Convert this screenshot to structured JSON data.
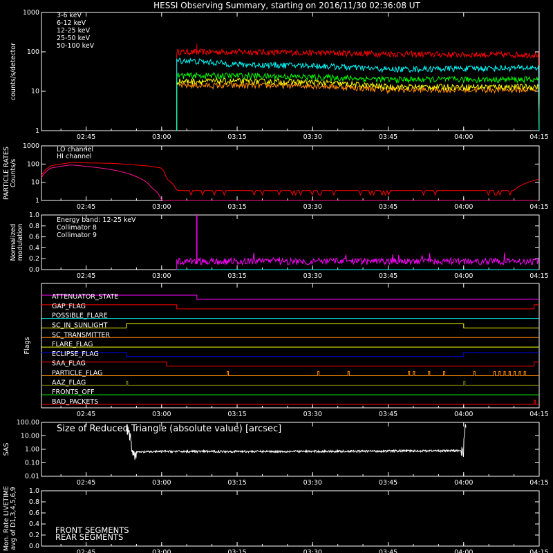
{
  "title": "HESSI Observing Summary, starting on 2016/11/30 02:36:08 UT",
  "time_ticks": [
    "02:45",
    "03:00",
    "03:15",
    "03:30",
    "03:45",
    "04:00",
    "04:15"
  ],
  "time_range": [
    "02:36:08",
    "04:15:00"
  ],
  "chart_data": [
    {
      "type": "line",
      "ylabel": "counts/s/detector",
      "yscale": "log",
      "ylim": [
        1,
        1000
      ],
      "ytick_labels": [
        "1",
        "10",
        "100",
        "1000"
      ],
      "legend_position": "top-left",
      "start": "03:03",
      "end": "04:15",
      "x": [
        "03:05",
        "03:15",
        "03:30",
        "03:45",
        "04:00",
        "04:15"
      ],
      "series": [
        {
          "name": "3-6 keV",
          "color": "#ff0000",
          "values": [
            100,
            100,
            95,
            90,
            85,
            85
          ]
        },
        {
          "name": "6-12 keV",
          "color": "#ff8c00",
          "values": [
            14,
            14,
            14,
            11,
            11,
            11
          ]
        },
        {
          "name": "12-25 keV",
          "color": "#ffff00",
          "values": [
            18,
            18,
            17,
            13,
            13,
            13
          ]
        },
        {
          "name": "25-50 keV",
          "color": "#00ff00",
          "values": [
            25,
            25,
            23,
            20,
            20,
            20
          ]
        },
        {
          "name": "50-100 keV",
          "color": "#00ffff",
          "values": [
            60,
            48,
            45,
            36,
            38,
            40
          ]
        }
      ]
    },
    {
      "type": "line",
      "ylabel": "PARTICLE RATES Counts/s",
      "yscale": "log",
      "ylim": [
        1,
        1000
      ],
      "ytick_labels": [
        "1",
        "10",
        "100",
        "1000"
      ],
      "legend_position": "top-left",
      "series": [
        {
          "name": "LO channel",
          "color": "#ff0000",
          "x": [
            "02:36",
            "02:38",
            "02:42",
            "02:50",
            "02:57",
            "03:00",
            "03:01",
            "03:03",
            "04:10",
            "04:15"
          ],
          "values": [
            20,
            80,
            120,
            110,
            80,
            60,
            15,
            3.5,
            3.5,
            15
          ]
        },
        {
          "name": "HI channel",
          "color": "#ff1493",
          "x": [
            "02:36",
            "02:38",
            "02:42",
            "02:50",
            "02:55",
            "02:58",
            "03:00",
            "04:15"
          ],
          "values": [
            15,
            60,
            90,
            50,
            20,
            5,
            1,
            1
          ]
        }
      ]
    },
    {
      "type": "line",
      "ylabel": "Normalized modulation",
      "ylim": [
        0,
        1.0
      ],
      "ytick_labels": [
        "0.0",
        "0.2",
        "0.4",
        "0.6",
        "0.8",
        "1.0"
      ],
      "legend_position": "top-left",
      "energy_band_label": "Energy band: 12-25 keV",
      "spike": {
        "x": "03:07",
        "value": 1.0
      },
      "series": [
        {
          "name": "Collimator 8",
          "color": "#00ffff",
          "start": "03:03",
          "end": "04:15",
          "values": [
            0,
            0
          ]
        },
        {
          "name": "Collimator 9",
          "color": "#ff00ff",
          "start": "03:03",
          "end": "04:15",
          "values": [
            0.15,
            0.15
          ]
        }
      ]
    },
    {
      "type": "flags",
      "ylabel": "Flags",
      "flags": [
        {
          "name": "ATTENUATOR_STATE",
          "color": "#ff00ff",
          "states": [
            [
              "02:36",
              "03:07",
              1
            ],
            [
              "03:07",
              "04:15",
              0
            ]
          ]
        },
        {
          "name": "GAP_FLAG",
          "color": "#ff0000",
          "states": [
            [
              "02:36",
              "03:03",
              1
            ],
            [
              "03:03",
              "04:14",
              0
            ],
            [
              "04:14",
              "04:15",
              1
            ]
          ]
        },
        {
          "name": "POSSIBLE_FLARE",
          "color": "#00ffff",
          "states": [
            [
              "02:36",
              "04:15",
              0
            ]
          ]
        },
        {
          "name": "SC_IN_SUNLIGHT",
          "color": "#ffff00",
          "states": [
            [
              "02:36",
              "02:53",
              0
            ],
            [
              "02:53",
              "04:00",
              1
            ],
            [
              "04:00",
              "04:15",
              0
            ]
          ]
        },
        {
          "name": "SC_TRANSMITTER",
          "color": "#ff8c00",
          "states": [
            [
              "02:36",
              "04:15",
              0
            ]
          ]
        },
        {
          "name": "FLARE_FLAG",
          "color": "#ffff00",
          "states": [
            [
              "02:36",
              "04:15",
              0
            ]
          ]
        },
        {
          "name": "ECLIPSE_FLAG",
          "color": "#0000ff",
          "states": [
            [
              "02:36",
              "02:53",
              1
            ],
            [
              "02:53",
              "04:00",
              0
            ],
            [
              "04:00",
              "04:15",
              1
            ]
          ]
        },
        {
          "name": "SAA_FLAG",
          "color": "#ff0000",
          "states": [
            [
              "02:36",
              "03:01",
              1
            ],
            [
              "03:01",
              "04:14",
              0
            ],
            [
              "04:14",
              "04:15",
              1
            ]
          ]
        },
        {
          "name": "PARTICLE_FLAG",
          "color": "#ff8c00",
          "pulses": [
            "03:13",
            "03:31",
            "03:37",
            "03:49",
            "03:50",
            "03:53",
            "03:56",
            "04:02",
            "04:06",
            "04:07",
            "04:08",
            "04:09",
            "04:10",
            "04:11",
            "04:12"
          ]
        },
        {
          "name": "AAZ_FLAG",
          "color": "#808000",
          "pulses": [
            "02:53",
            "04:00"
          ]
        },
        {
          "name": "FRONTS_OFF",
          "color": "#00ff00",
          "states": [
            [
              "02:36",
              "04:15",
              0
            ]
          ]
        },
        {
          "name": "BAD_PACKETS",
          "color": "#ff0000",
          "pulses": [
            "04:14"
          ]
        }
      ]
    },
    {
      "type": "line",
      "ylabel": "SAS",
      "yscale": "log",
      "ylim": [
        0.01,
        100
      ],
      "ytick_labels": [
        "0.01",
        "0.10",
        "1.00",
        "10.00",
        "100.00"
      ],
      "annotation": "Size of Reduced Triangle (absolute value) [arcsec]",
      "series": [
        {
          "color": "#ffffff",
          "x": [
            "02:53",
            "02:54",
            "03:00",
            "03:30",
            "04:00",
            "04:00:30"
          ],
          "values": [
            50,
            0.6,
            0.7,
            0.7,
            0.8,
            60
          ]
        }
      ]
    },
    {
      "type": "line",
      "ylabel": "Mon. Rate LIVETIME avg of D1,3,4,5,6,9",
      "ylim": [
        0.0,
        1.0
      ],
      "ytick_labels": [
        "0.0",
        "0.2",
        "0.4",
        "0.6",
        "0.8",
        "1.0"
      ],
      "legend_position": "bottom-left",
      "series": [
        {
          "name": "FRONT SEGMENTS",
          "color": "#00ff00",
          "values": []
        },
        {
          "name": "REAR SEGMENTS",
          "color": "#008000",
          "values": []
        }
      ]
    }
  ]
}
